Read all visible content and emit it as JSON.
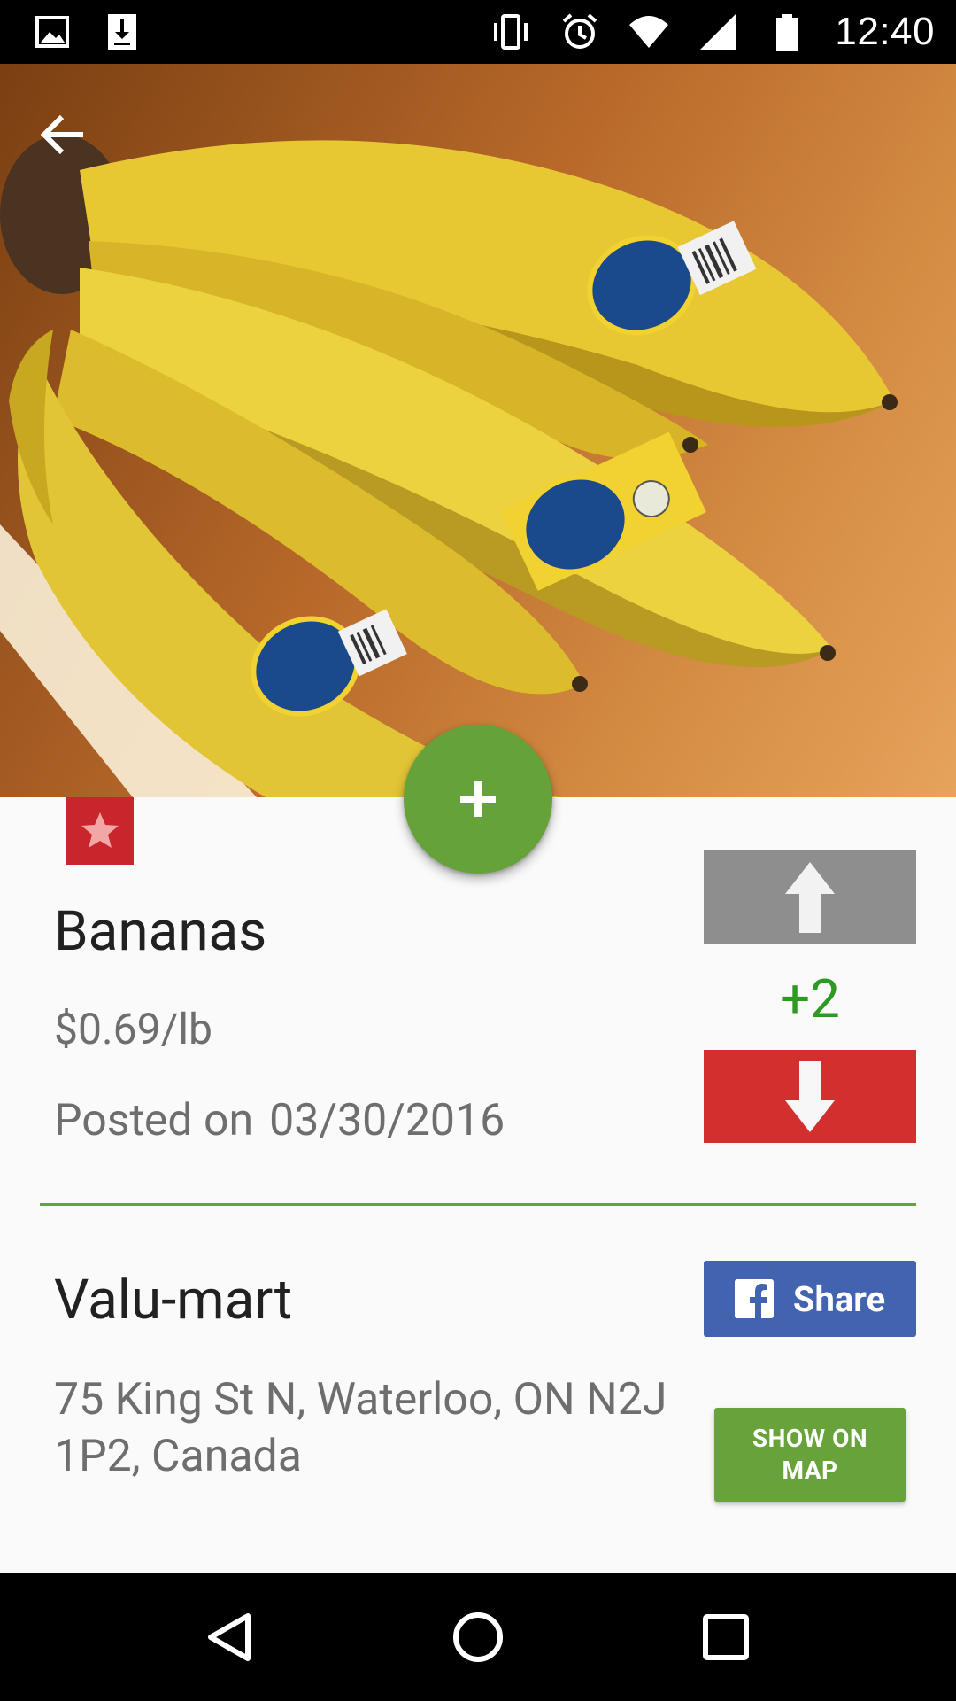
{
  "status_bar": {
    "time": "12:40",
    "left_icons": [
      "image-icon",
      "download-icon"
    ],
    "right_icons": [
      "vibrate-icon",
      "alarm-icon",
      "wifi-icon",
      "signal-icon",
      "battery-icon"
    ]
  },
  "hero": {
    "image": "bananas-photo",
    "back_icon": "arrow-back-icon"
  },
  "fab": {
    "icon": "plus-icon"
  },
  "favorite": {
    "icon": "star-icon",
    "color": "#c8252d"
  },
  "product": {
    "name": "Bananas",
    "price": "$0.69/lb",
    "posted_label": "Posted on",
    "posted_date": "03/30/2016"
  },
  "votes": {
    "score": "+2",
    "score_color": "#2e9a24",
    "up_icon": "arrow-up-icon",
    "down_icon": "arrow-down-icon",
    "up_color": "#8e8e8e",
    "down_color": "#d32f2f"
  },
  "store": {
    "name": "Valu-mart",
    "address": "75 King St N, Waterloo, ON N2J 1P2, Canada"
  },
  "actions": {
    "share_label": "Share",
    "map_label": "SHOW ON MAP"
  },
  "colors": {
    "accent_green": "#66a23a",
    "facebook_blue": "#4263b0"
  },
  "nav_bar": {
    "buttons": [
      "back-triangle-icon",
      "home-circle-icon",
      "recents-square-icon"
    ]
  }
}
